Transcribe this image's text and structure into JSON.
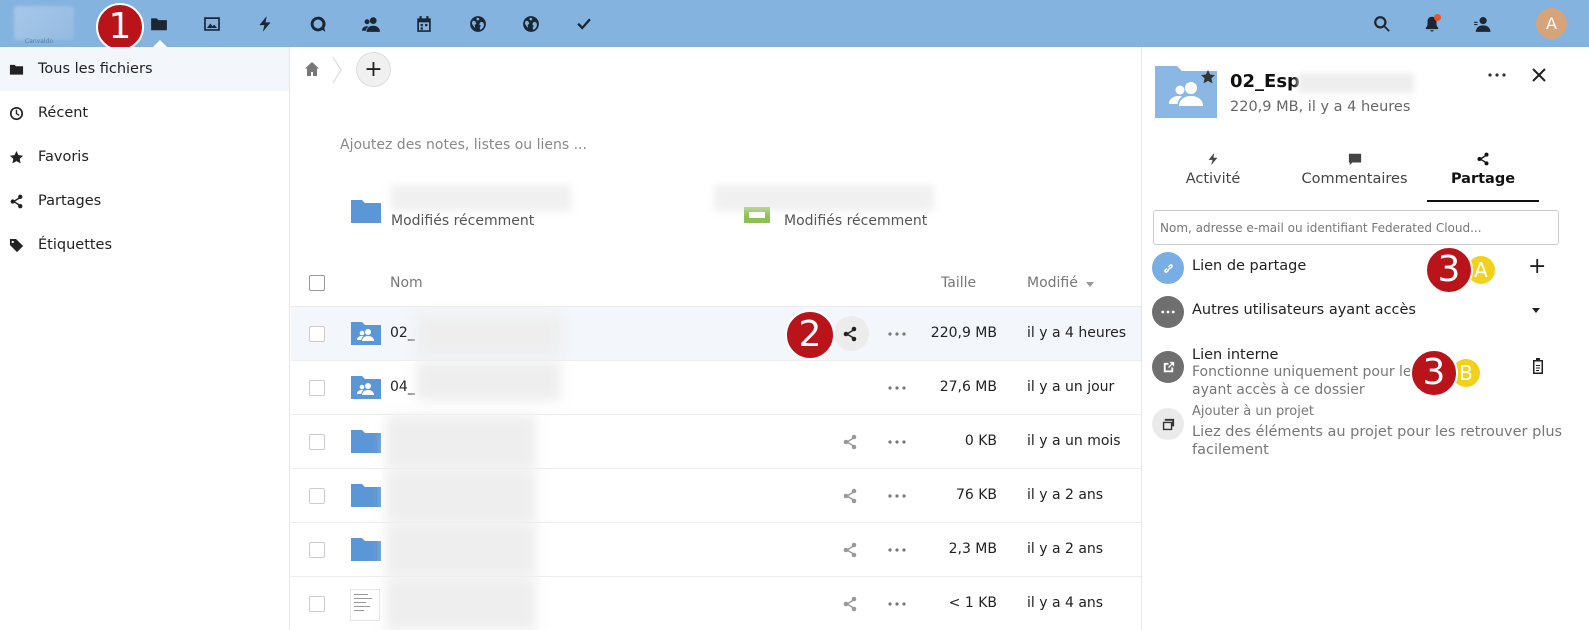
{
  "header": {
    "logo_text": "Canvaldo",
    "apps": [
      {
        "name": "files-icon"
      },
      {
        "name": "photos-icon"
      },
      {
        "name": "activity-icon"
      },
      {
        "name": "talk-icon"
      },
      {
        "name": "contacts-icon"
      },
      {
        "name": "calendar-icon"
      },
      {
        "name": "globe-icon"
      },
      {
        "name": "globe-icon-2"
      },
      {
        "name": "tasks-icon"
      }
    ],
    "avatar_letter": "A"
  },
  "callouts": {
    "one": "1",
    "two": "2",
    "three_a": "3",
    "three_a_letter": "A",
    "three_b": "3",
    "three_b_letter": "B"
  },
  "sidebar": {
    "items": [
      {
        "label": "Tous les fichiers"
      },
      {
        "label": "Récent"
      },
      {
        "label": "Favoris"
      },
      {
        "label": "Partages"
      },
      {
        "label": "Étiquettes"
      }
    ]
  },
  "main": {
    "add_label": "+",
    "notes_placeholder": "Ajoutez des notes, listes ou liens ...",
    "recent_1": "Modifiés récemment",
    "recent_2": "Modifiés récemment",
    "columns": {
      "name": "Nom",
      "size": "Taille",
      "modified": "Modifié"
    },
    "rows": [
      {
        "name": "02_",
        "size": "220,9 MB",
        "modified": "il y a 4 heures"
      },
      {
        "name": "04_",
        "size": "27,6 MB",
        "modified": "il y a un jour"
      },
      {
        "name": "",
        "size": "0 KB",
        "modified": "il y a un mois"
      },
      {
        "name": "",
        "size": "76 KB",
        "modified": "il y a 2 ans"
      },
      {
        "name": "",
        "size": "2,3 MB",
        "modified": "il y a 2 ans"
      },
      {
        "name": "",
        "size": "< 1 KB",
        "modified": "il y a 4 ans"
      }
    ]
  },
  "panel": {
    "title": "02_Esp",
    "subtitle": "220,9 MB, il y a 4 heures",
    "tabs": [
      {
        "label": "Activité"
      },
      {
        "label": "Commentaires"
      },
      {
        "label": "Partage"
      }
    ],
    "search_placeholder": "Nom, adresse e-mail ou identifiant Federated Cloud...",
    "share_link": "Lien de partage",
    "share_link_add": "+",
    "others": "Autres utilisateurs ayant accès",
    "internal_title": "Lien interne",
    "internal_line1": "Fonctionne uniquement pour les u",
    "internal_line2": "ayant accès à ce dossier",
    "project_title": "Ajouter à un projet",
    "project_line1": "Liez des éléments au projet pour les retrouver plus",
    "project_line2": "facilement"
  },
  "colors": {
    "header": "#84b3e0",
    "callout": "#b8141a",
    "callout_sub": "#f1d11b",
    "folder": "#5b97d6",
    "link_circle": "#79aee5",
    "grey_circle": "#6f6f6f"
  }
}
